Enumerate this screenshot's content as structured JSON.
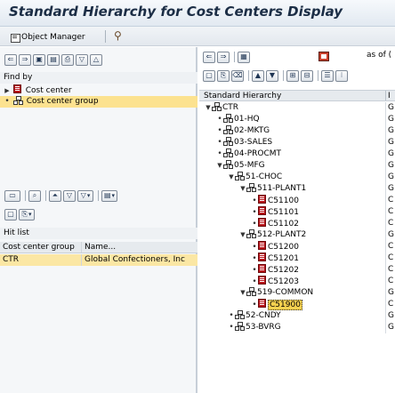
{
  "window": {
    "title": "Standard Hierarchy for Cost Centers Display"
  },
  "app_toolbar": {
    "object_manager_label": "Object Manager",
    "icons": [
      "object-manager-icon",
      "wand-icon"
    ]
  },
  "left_pane": {
    "find_by_label": "Find by",
    "find_by_items": [
      {
        "label": "Cost center",
        "expanded": false,
        "selected": false,
        "icon": "cost-center-icon"
      },
      {
        "label": "Cost center group",
        "expanded": false,
        "selected": true,
        "icon": "group-icon"
      }
    ],
    "hit_list_label": "Hit list",
    "grid": {
      "columns": [
        "Cost center group",
        "Name..."
      ],
      "rows": [
        {
          "group": "CTR",
          "name": "Global Confectioners, Inc"
        }
      ]
    }
  },
  "right_pane": {
    "as_of_label": "as of",
    "as_of_value": "(",
    "columns": [
      "Standard Hierarchy",
      "I"
    ],
    "tree": [
      {
        "level": 0,
        "toggle": "expanded",
        "icon": "group",
        "label": "CTR",
        "col2": "G"
      },
      {
        "level": 1,
        "toggle": "leaf",
        "icon": "group",
        "label": "01-HQ",
        "col2": "G"
      },
      {
        "level": 1,
        "toggle": "leaf",
        "icon": "group",
        "label": "02-MKTG",
        "col2": "G"
      },
      {
        "level": 1,
        "toggle": "leaf",
        "icon": "group",
        "label": "03-SALES",
        "col2": "G"
      },
      {
        "level": 1,
        "toggle": "leaf",
        "icon": "group",
        "label": "04-PROCMT",
        "col2": "G"
      },
      {
        "level": 1,
        "toggle": "expanded",
        "icon": "group",
        "label": "05-MFG",
        "col2": "G"
      },
      {
        "level": 2,
        "toggle": "expanded",
        "icon": "group",
        "label": "51-CHOC",
        "col2": "G"
      },
      {
        "level": 3,
        "toggle": "expanded",
        "icon": "group",
        "label": "511-PLANT1",
        "col2": "G"
      },
      {
        "level": 4,
        "toggle": "leaf",
        "icon": "cc",
        "label": "C51100",
        "col2": "C"
      },
      {
        "level": 4,
        "toggle": "leaf",
        "icon": "cc",
        "label": "C51101",
        "col2": "C"
      },
      {
        "level": 4,
        "toggle": "leaf",
        "icon": "cc",
        "label": "C51102",
        "col2": "C"
      },
      {
        "level": 3,
        "toggle": "expanded",
        "icon": "group",
        "label": "512-PLANT2",
        "col2": "G"
      },
      {
        "level": 4,
        "toggle": "leaf",
        "icon": "cc",
        "label": "C51200",
        "col2": "C"
      },
      {
        "level": 4,
        "toggle": "leaf",
        "icon": "cc",
        "label": "C51201",
        "col2": "C"
      },
      {
        "level": 4,
        "toggle": "leaf",
        "icon": "cc",
        "label": "C51202",
        "col2": "C"
      },
      {
        "level": 4,
        "toggle": "leaf",
        "icon": "cc",
        "label": "C51203",
        "col2": "C"
      },
      {
        "level": 3,
        "toggle": "expanded",
        "icon": "group",
        "label": "519-COMMON",
        "col2": "G"
      },
      {
        "level": 4,
        "toggle": "leaf",
        "icon": "cc",
        "label": "C51900",
        "col2": "C",
        "highlighted": true
      },
      {
        "level": 2,
        "toggle": "leaf",
        "icon": "group",
        "label": "52-CNDY",
        "col2": "G"
      },
      {
        "level": 2,
        "toggle": "leaf",
        "icon": "group",
        "label": "53-BVRG",
        "col2": "G"
      }
    ]
  }
}
